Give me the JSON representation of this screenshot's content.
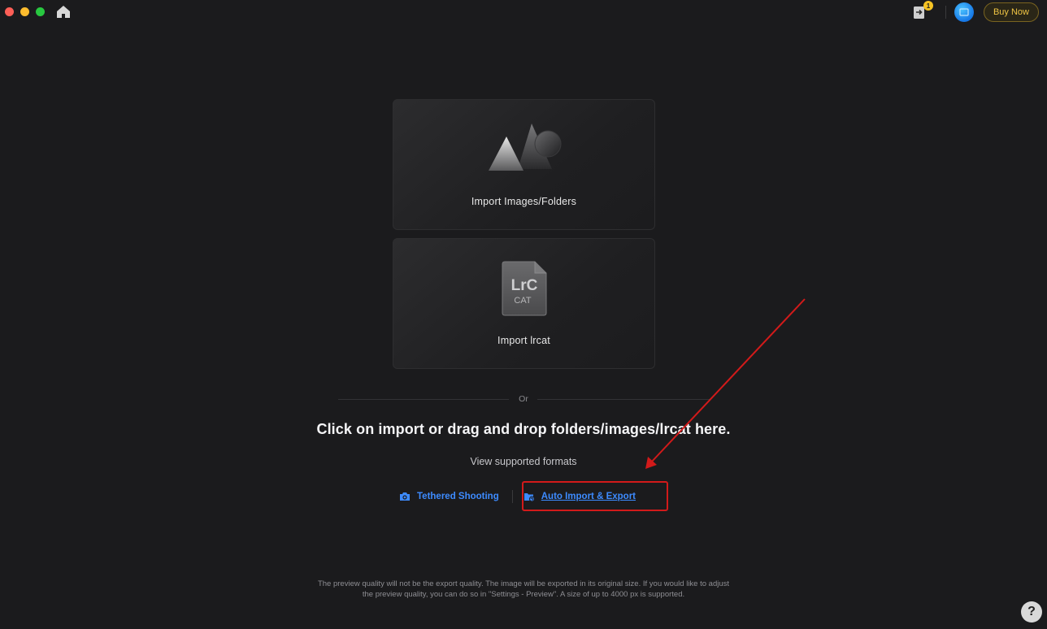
{
  "titlebar": {
    "tasks_badge": "1",
    "buy_label": "Buy Now"
  },
  "cards": {
    "import_images_label": "Import Images/Folders",
    "import_lrcat_label": "Import lrcat",
    "lrcat_icon_top": "LrC",
    "lrcat_icon_bottom": "CAT"
  },
  "divider_text": "Or",
  "headline": "Click on import or drag and drop folders/images/lrcat here.",
  "formats_link": "View supported formats",
  "actions": {
    "tethered": "Tethered Shooting",
    "auto_import": "Auto Import & Export"
  },
  "footnote": {
    "line1": "The preview quality will not be the export quality. The image will be exported in its original size. If you would like to adjust",
    "line2": "the preview quality, you can do so in \"Settings - Preview\". A size of up to 4000 px is supported."
  },
  "help_label": "?",
  "icons": {
    "home": "home-icon",
    "tasks": "tasks-icon",
    "avatar": "avatar",
    "mountain": "mountain-icon",
    "lrcat": "lrcat-file-icon",
    "camera": "camera-icon",
    "folder_sync": "folder-sync-icon"
  },
  "colors": {
    "accent_link": "#3d8bff",
    "buy_text": "#f0c544",
    "annotation_red": "#d21a1a"
  }
}
